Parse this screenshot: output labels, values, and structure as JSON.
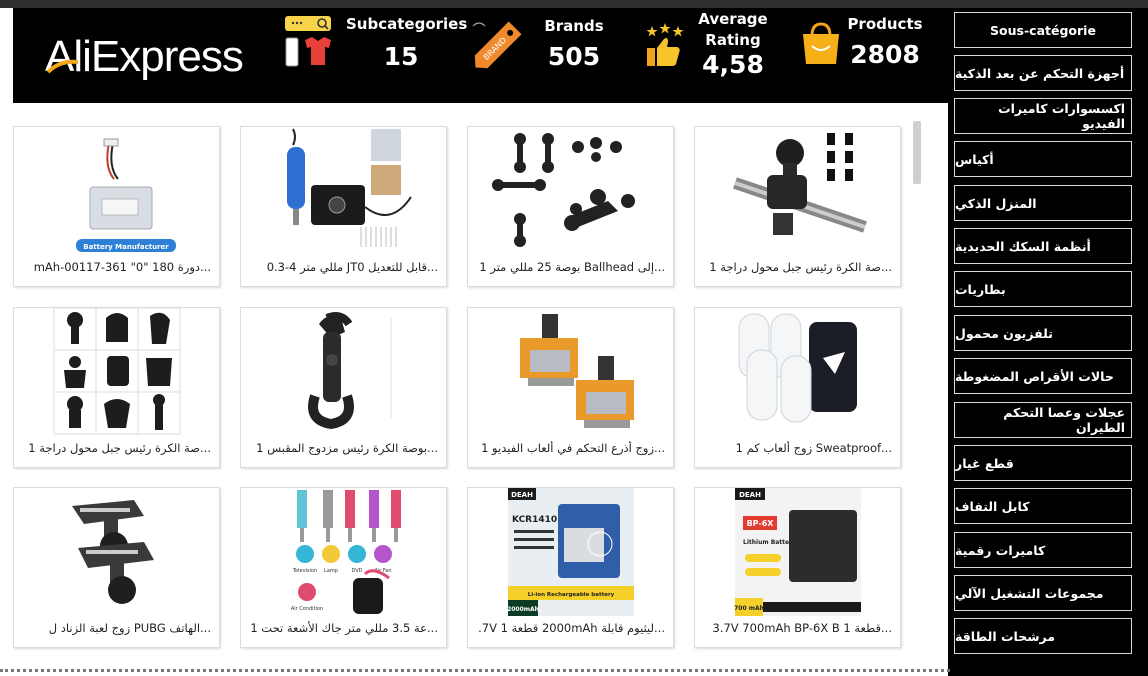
{
  "header": {
    "logo_text": "AliExpress",
    "stats": {
      "subcategories": {
        "label": "Subcategories",
        "value": "15",
        "icon": "search-bar-shirt-icon"
      },
      "brands": {
        "label": "Brands",
        "value": "505",
        "icon": "price-tag-icon",
        "tag_text": "BRAND"
      },
      "rating": {
        "label_line1": "Average",
        "label_line2": "Rating",
        "value": "4,58",
        "icon": "thumbs-up-stars-icon"
      },
      "products": {
        "label": "Products",
        "value": "2808",
        "icon": "shopping-bag-icon"
      }
    },
    "accent_color": "#f5a81b"
  },
  "sidebar": {
    "items": [
      {
        "label": "Sous-catégorie"
      },
      {
        "label": "أجهزة التحكم عن بعد الذكية"
      },
      {
        "label": "اكسسوارات كاميرات الفيديو"
      },
      {
        "label": "أكياس"
      },
      {
        "label": "المنزل الذكي"
      },
      {
        "label": "أنظمة السكك الحديدية"
      },
      {
        "label": "بطاريات"
      },
      {
        "label": "تلفزيون محمول"
      },
      {
        "label": "حالات الأقراص المضغوطة"
      },
      {
        "label": "عجلات وعصا التحكم الطيران"
      },
      {
        "label": "قطع غيار"
      },
      {
        "label": "كابل التفاف"
      },
      {
        "label": "كاميرات رقمية"
      },
      {
        "label": "مجموعات التشغيل الآلي"
      },
      {
        "label": "مرشحات الطاقة"
      }
    ]
  },
  "products": [
    {
      "title": "...دورة 180 \"0\" 361-00117-mAh",
      "image": "battery-pack-image",
      "img_text": "Battery Manufacturer"
    },
    {
      "title": "...قابل للتعديل JT0 مللي متر 4-0.3",
      "image": "blue-rotary-tool-image"
    },
    {
      "title": "...إلى Ballhead بوصة 25 مللي متر 1",
      "image": "ball-mount-arms-image"
    },
    {
      "title": "...صة الكرة رئيس جبل محول دراجة 1",
      "image": "handlebar-ball-mount-image"
    },
    {
      "title": "...صة الكرة رئيس جبل محول دراجة 1",
      "image": "mount-set-grid-image"
    },
    {
      "title": "...بوصة الكرة رئيس مزدوج المقبس 1",
      "image": "double-socket-clamp-image"
    },
    {
      "title": "...زوج أذرع التحكم في ألعاب الفيديو 1",
      "image": "joystick-modules-image"
    },
    {
      "title": "...Sweatproof زوج ألعاب كم 1",
      "image": "finger-sleeves-image"
    },
    {
      "title": "...الهاتف PUBG زوج لعبة الزناد ل",
      "image": "pubg-triggers-image"
    },
    {
      "title": "...عة 3.5 مللي متر جاك الأشعة تحت 1",
      "image": "ir-jack-cables-image",
      "img_labels": [
        "Television",
        "Lamp",
        "DVD",
        "Air Fan",
        "Air Condition"
      ]
    },
    {
      "title": "...ليثيوم قابلة 2000mAh قطعة 3.7V 1",
      "image": "kcr1410-battery-image",
      "img_text": "KCR1410",
      "img_sub": "Li-ion Rechargeable battery",
      "img_cap": "2000mAh",
      "brand": "DEAH"
    },
    {
      "title": "...قطعة 3.7V 700mAh BP-6X B 1",
      "image": "bp6x-battery-image",
      "img_text": "BP-6X",
      "img_sub": "Lithium Battery",
      "img_cap": "700 mAh",
      "brand": "DEAH"
    }
  ]
}
